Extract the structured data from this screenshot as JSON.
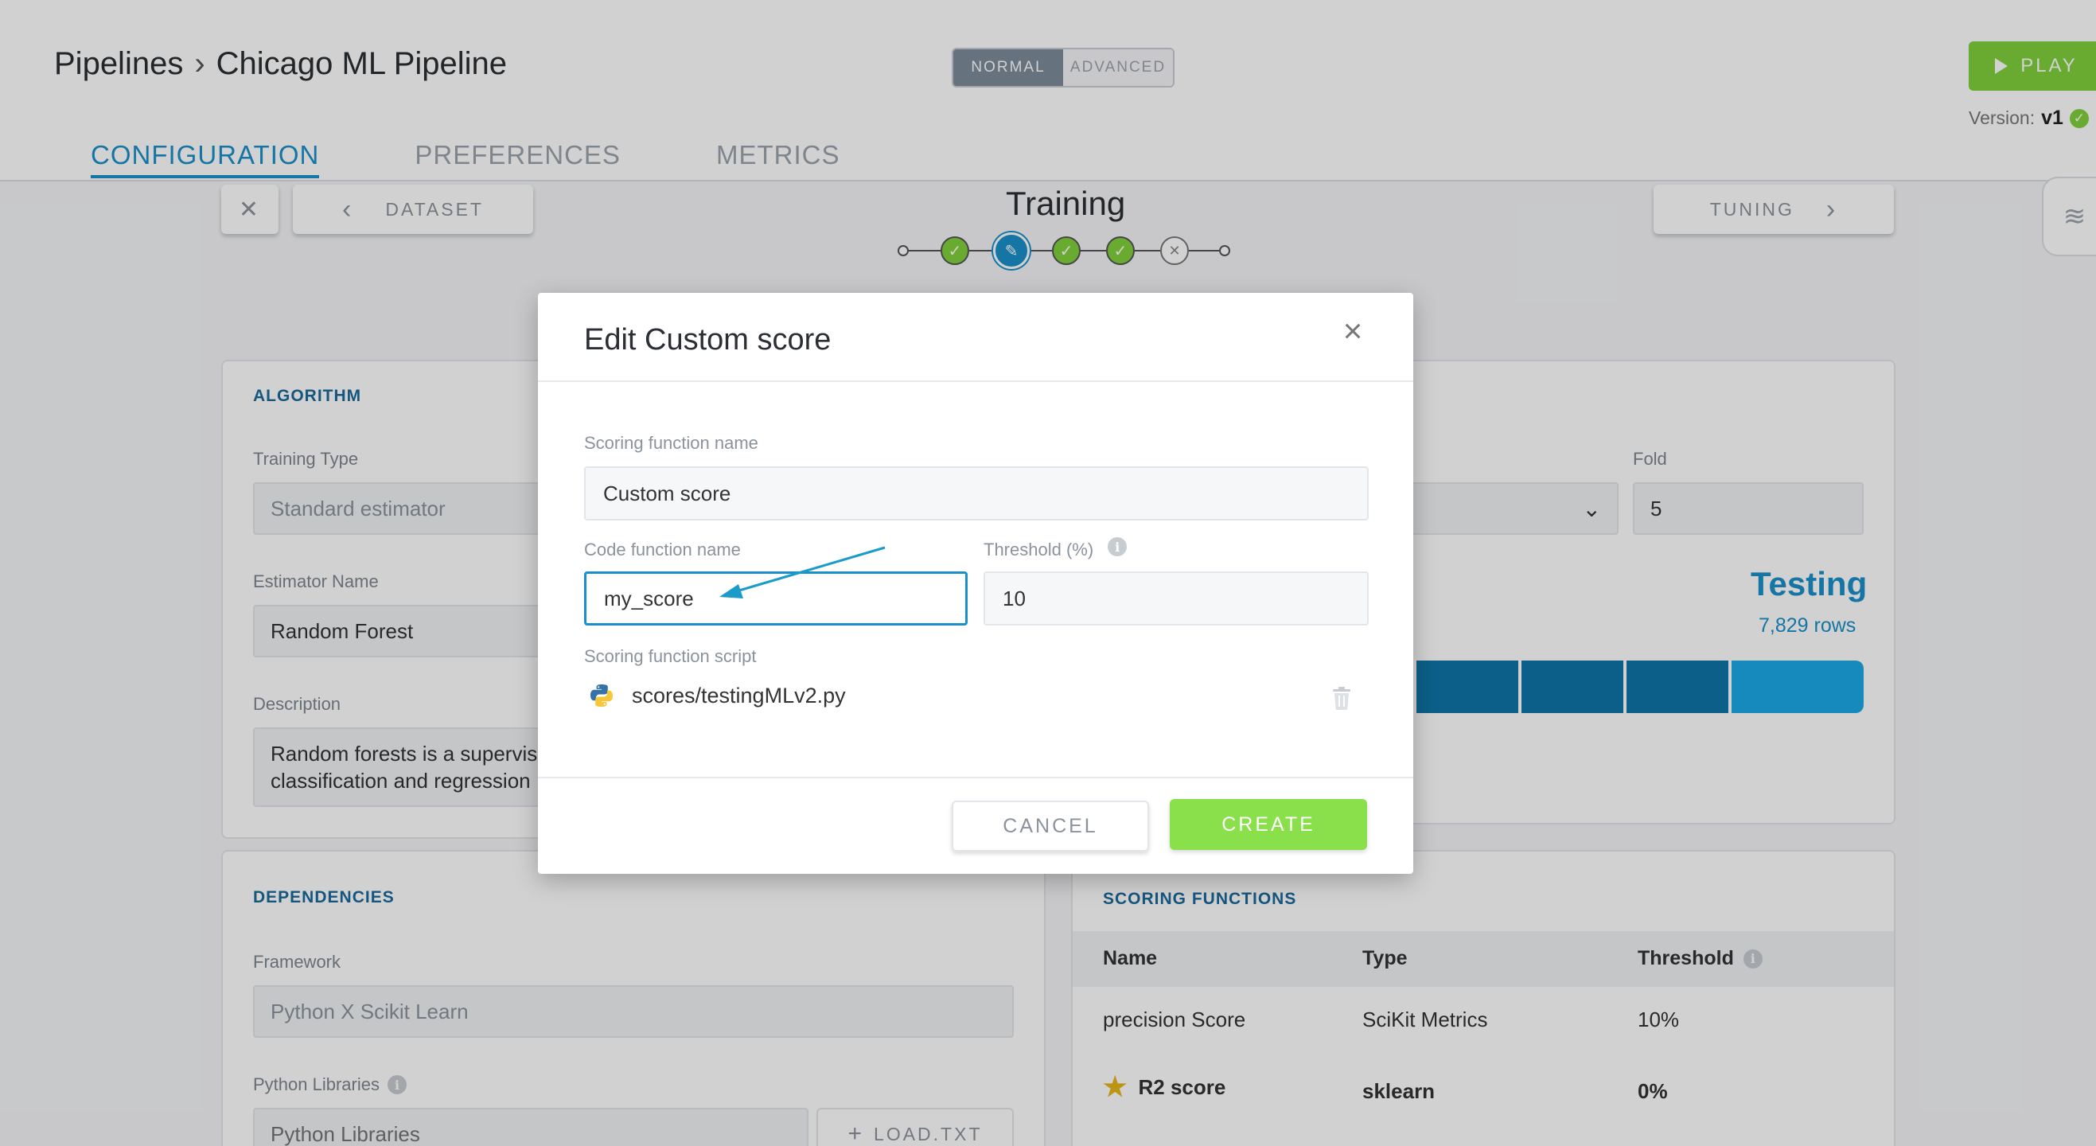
{
  "header": {
    "breadcrumb_root": "Pipelines",
    "breadcrumb_current": "Chicago ML Pipeline",
    "mode_normal": "NORMAL",
    "mode_advanced": "ADVANCED",
    "play_label": "PLAY",
    "version_label": "Version:",
    "version_value": "v1"
  },
  "tabs": [
    {
      "label": "CONFIGURATION",
      "active": true
    },
    {
      "label": "PREFERENCES",
      "active": false
    },
    {
      "label": "METRICS",
      "active": false
    }
  ],
  "step_nav": {
    "prev_label": "DATASET",
    "title": "Training",
    "next_label": "TUNING"
  },
  "algorithm": {
    "section_title": "ALGORITHM",
    "training_type_label": "Training Type",
    "training_type_value": "Standard estimator",
    "estimator_label": "Estimator Name",
    "estimator_value": "Random Forest",
    "description_label": "Description",
    "description_line1": "Random forests is a supervise",
    "description_line2": "classification and regression"
  },
  "validation": {
    "fold_label": "Fold",
    "fold_value": "5",
    "testing_label": "Testing",
    "testing_rows": "7,829 rows"
  },
  "dependencies": {
    "section_title": "DEPENDENCIES",
    "framework_label": "Framework",
    "framework_value": "Python X Scikit Learn",
    "libraries_label": "Python Libraries",
    "libraries_placeholder": "Python Libraries",
    "load_label": "LOAD.TXT"
  },
  "scoring_functions": {
    "section_title": "SCORING FUNCTIONS",
    "columns": [
      "Name",
      "Type",
      "Threshold"
    ],
    "rows": [
      {
        "name": "precision Score",
        "type": "SciKit Metrics",
        "threshold": "10%"
      },
      {
        "name": "R2 score",
        "type": "sklearn",
        "threshold": "0%"
      }
    ]
  },
  "modal": {
    "title": "Edit Custom score",
    "scoring_name_label": "Scoring function name",
    "scoring_name_value": "Custom score",
    "code_name_label": "Code function name",
    "code_name_value": "my_score",
    "threshold_label": "Threshold (%)",
    "threshold_value": "10",
    "script_label": "Scoring function script",
    "script_path": "scores/testingMLv2.py",
    "cancel_label": "CANCEL",
    "create_label": "CREATE"
  },
  "colors": {
    "accent": "#1a8fc9",
    "success": "#7fd13b",
    "create": "#8ae04a"
  }
}
